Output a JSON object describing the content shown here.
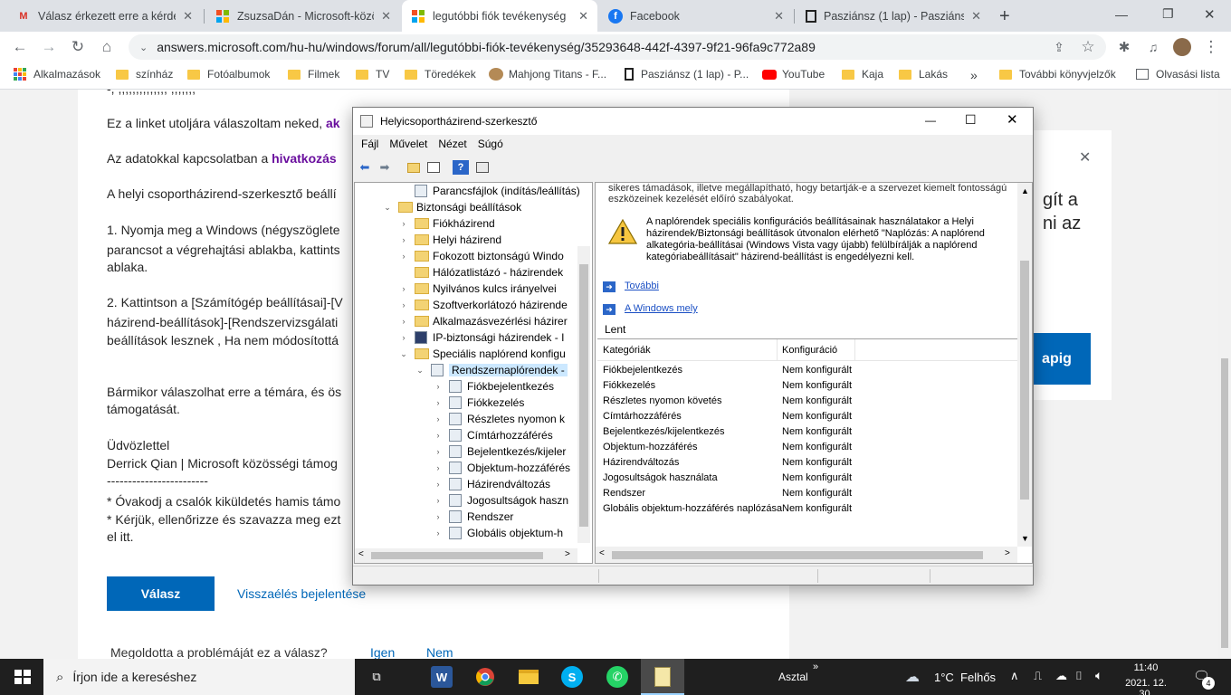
{
  "tabs": [
    {
      "title": "Válasz érkezett erre a kérdés",
      "icon": "gmail-icon",
      "active": false
    },
    {
      "title": "ZsuzsaDán - Microsoft-közös",
      "icon": "microsoft-icon",
      "active": false
    },
    {
      "title": "legutóbbi fiók tevékenység",
      "icon": "microsoft-icon",
      "active": true
    },
    {
      "title": "Facebook",
      "icon": "facebook-icon",
      "active": false
    },
    {
      "title": "Pasziánsz (1 lap) - Pasziánsz",
      "icon": "solitaire-icon",
      "active": false
    }
  ],
  "address_url": "answers.microsoft.com/hu-hu/windows/forum/all/legutóbbi-fiók-tevékenység/35293648-442f-4397-9f21-96fa9c772a89",
  "bookmarks": [
    "Alkalmazások",
    "színház",
    "Fotóalbumok",
    "Filmek",
    "TV",
    "Töredékek",
    "Mahjong Titans - F...",
    "Pasziánsz (1 lap) - P...",
    "YouTube",
    "Kaja",
    "Lakás"
  ],
  "bookmarks_more": "»",
  "bookmarks_other": "További könyvjelzők",
  "reading_list": "Olvasási lista",
  "article": {
    "line0": "-, ,,,,,,,,,,,,,, ,,,,,,,",
    "line1_pre": "Ez a linket utoljára válaszoltam neked, ",
    "line1_bold": "ak",
    "line2_pre": "Az adatokkal kapcsolatban a ",
    "line2_bold": "hivatkozás",
    "line3": "A helyi csoportházirend-szerkesztő beállí",
    "line4": "1. Nyomja meg a Windows (négyszöglete",
    "line5": "parancsot a végrehajtási ablakba, kattints",
    "line6": "ablaka.",
    "line7": "2. Kattintson a [Számítógép beállításai]-[V",
    "line8": "házirend-beállítások]-[Rendszervizsgálati",
    "line9": "beállítások lesznek , Ha nem módosítottá",
    "line10": "Bármikor válaszolhat erre a témára, és ös",
    "line11": "támogatását.",
    "line12": "Üdvözlettel",
    "line13": "Derrick Qian | Microsoft közösségi támog",
    "line14": "------------------------",
    "line15": "* Óvakodj a csalók kiküldetés hamis támo",
    "line16": "* Kérjük, ellenőrizze és szavazza meg ezt",
    "line17": "el itt.",
    "reply_button": "Válasz",
    "report_link": "Visszaélés bejelentése",
    "solved_question": "Megoldotta a problémáját ez a válasz?",
    "yes": "Igen",
    "no": "Nem"
  },
  "side_panel": {
    "text1": "gít a",
    "text2": "ni az",
    "button": "apig"
  },
  "dialog": {
    "title": "Helyicsoportházirend-szerkesztő",
    "menu": [
      "Fájl",
      "Művelet",
      "Nézet",
      "Súgó"
    ],
    "tree": [
      {
        "label": "Parancsfájlok (indítás/leállítás)",
        "level": 3,
        "chev": "",
        "icon": "page"
      },
      {
        "label": "Biztonsági beállítások",
        "level": 2,
        "chev": "v",
        "icon": "lock"
      },
      {
        "label": "Fiókházirend",
        "level": 3,
        "chev": ">",
        "icon": "lock"
      },
      {
        "label": "Helyi házirend",
        "level": 3,
        "chev": ">",
        "icon": "lock"
      },
      {
        "label": "Fokozott biztonságú Windo",
        "level": 3,
        "chev": ">",
        "icon": "folder"
      },
      {
        "label": "Hálózatlistázó - házirendek",
        "level": 3,
        "chev": "",
        "icon": "folder"
      },
      {
        "label": "Nyilvános kulcs irányelvei",
        "level": 3,
        "chev": ">",
        "icon": "folder"
      },
      {
        "label": "Szoftverkorlátozó házirende",
        "level": 3,
        "chev": ">",
        "icon": "folder"
      },
      {
        "label": "Alkalmazásvezérlési házirer",
        "level": 3,
        "chev": ">",
        "icon": "folder"
      },
      {
        "label": "IP-biztonsági házirendek - I",
        "level": 3,
        "chev": ">",
        "icon": "shield"
      },
      {
        "label": "Speciális naplórend konfigu",
        "level": 3,
        "chev": "v",
        "icon": "folder"
      },
      {
        "label": "Rendszernaplórendek -",
        "level": 4,
        "chev": "v",
        "icon": "page",
        "selected": true
      },
      {
        "label": "Fiókbejelentkezés",
        "level": 5,
        "chev": ">",
        "icon": "page"
      },
      {
        "label": "Fiókkezelés",
        "level": 5,
        "chev": ">",
        "icon": "page"
      },
      {
        "label": "Részletes nyomon k",
        "level": 5,
        "chev": ">",
        "icon": "page"
      },
      {
        "label": "Címtárhozzáférés",
        "level": 5,
        "chev": ">",
        "icon": "page"
      },
      {
        "label": "Bejelentkezés/kijeler",
        "level": 5,
        "chev": ">",
        "icon": "page"
      },
      {
        "label": "Objektum-hozzáférés",
        "level": 5,
        "chev": ">",
        "icon": "page"
      },
      {
        "label": "Házirendváltozás",
        "level": 5,
        "chev": ">",
        "icon": "page"
      },
      {
        "label": "Jogosultságok haszn",
        "level": 5,
        "chev": ">",
        "icon": "page"
      },
      {
        "label": "Rendszer",
        "level": 5,
        "chev": ">",
        "icon": "page"
      },
      {
        "label": "Globális objektum-h",
        "level": 5,
        "chev": ">",
        "icon": "page"
      }
    ],
    "desc_top_1": "sikeres támadások, illetve megállapítható, hogy betartják-e a szervezet kiemelt fontosságú",
    "desc_top_2": "eszközeinek kezelését előíró szabályokat.",
    "warning_lines": [
      "A naplórendek speciális konfigurációs beállításainak használatakor a Helyi",
      "házirendek/Biztonsági beállítások útvonalon elérhető \"Naplózás: A naplórend",
      "alkategória-beállításai (Windows Vista vagy újabb) felülbírálják a naplórend",
      "kategóriabeállításait\" házirend-beállítást is engedélyezni kell."
    ],
    "link_more": "További",
    "link_windows": "A Windows mely",
    "lent": "Lent",
    "col_category": "Kategóriák",
    "col_config": "Konfiguráció",
    "rows": [
      {
        "category": "Fiókbejelentkezés",
        "config": "Nem konfigurált"
      },
      {
        "category": "Fiókkezelés",
        "config": "Nem konfigurált"
      },
      {
        "category": "Részletes nyomon követés",
        "config": "Nem konfigurált"
      },
      {
        "category": "Címtárhozzáférés",
        "config": "Nem konfigurált"
      },
      {
        "category": "Bejelentkezés/kijelentkezés",
        "config": "Nem konfigurált"
      },
      {
        "category": "Objektum-hozzáférés",
        "config": "Nem konfigurált"
      },
      {
        "category": "Házirendváltozás",
        "config": "Nem konfigurált"
      },
      {
        "category": "Jogosultságok használata",
        "config": "Nem konfigurált"
      },
      {
        "category": "Rendszer",
        "config": "Nem konfigurált"
      },
      {
        "category": "Globális objektum-hozzáférés naplózása",
        "config": "Nem konfigurált"
      }
    ]
  },
  "taskbar": {
    "search_placeholder": "Írjon ide a kereséshez",
    "desktop": "Asztal",
    "weather": "1°C  Felhős",
    "time": "11:40",
    "date": "2021. 12. 30.",
    "notifications": "4"
  }
}
